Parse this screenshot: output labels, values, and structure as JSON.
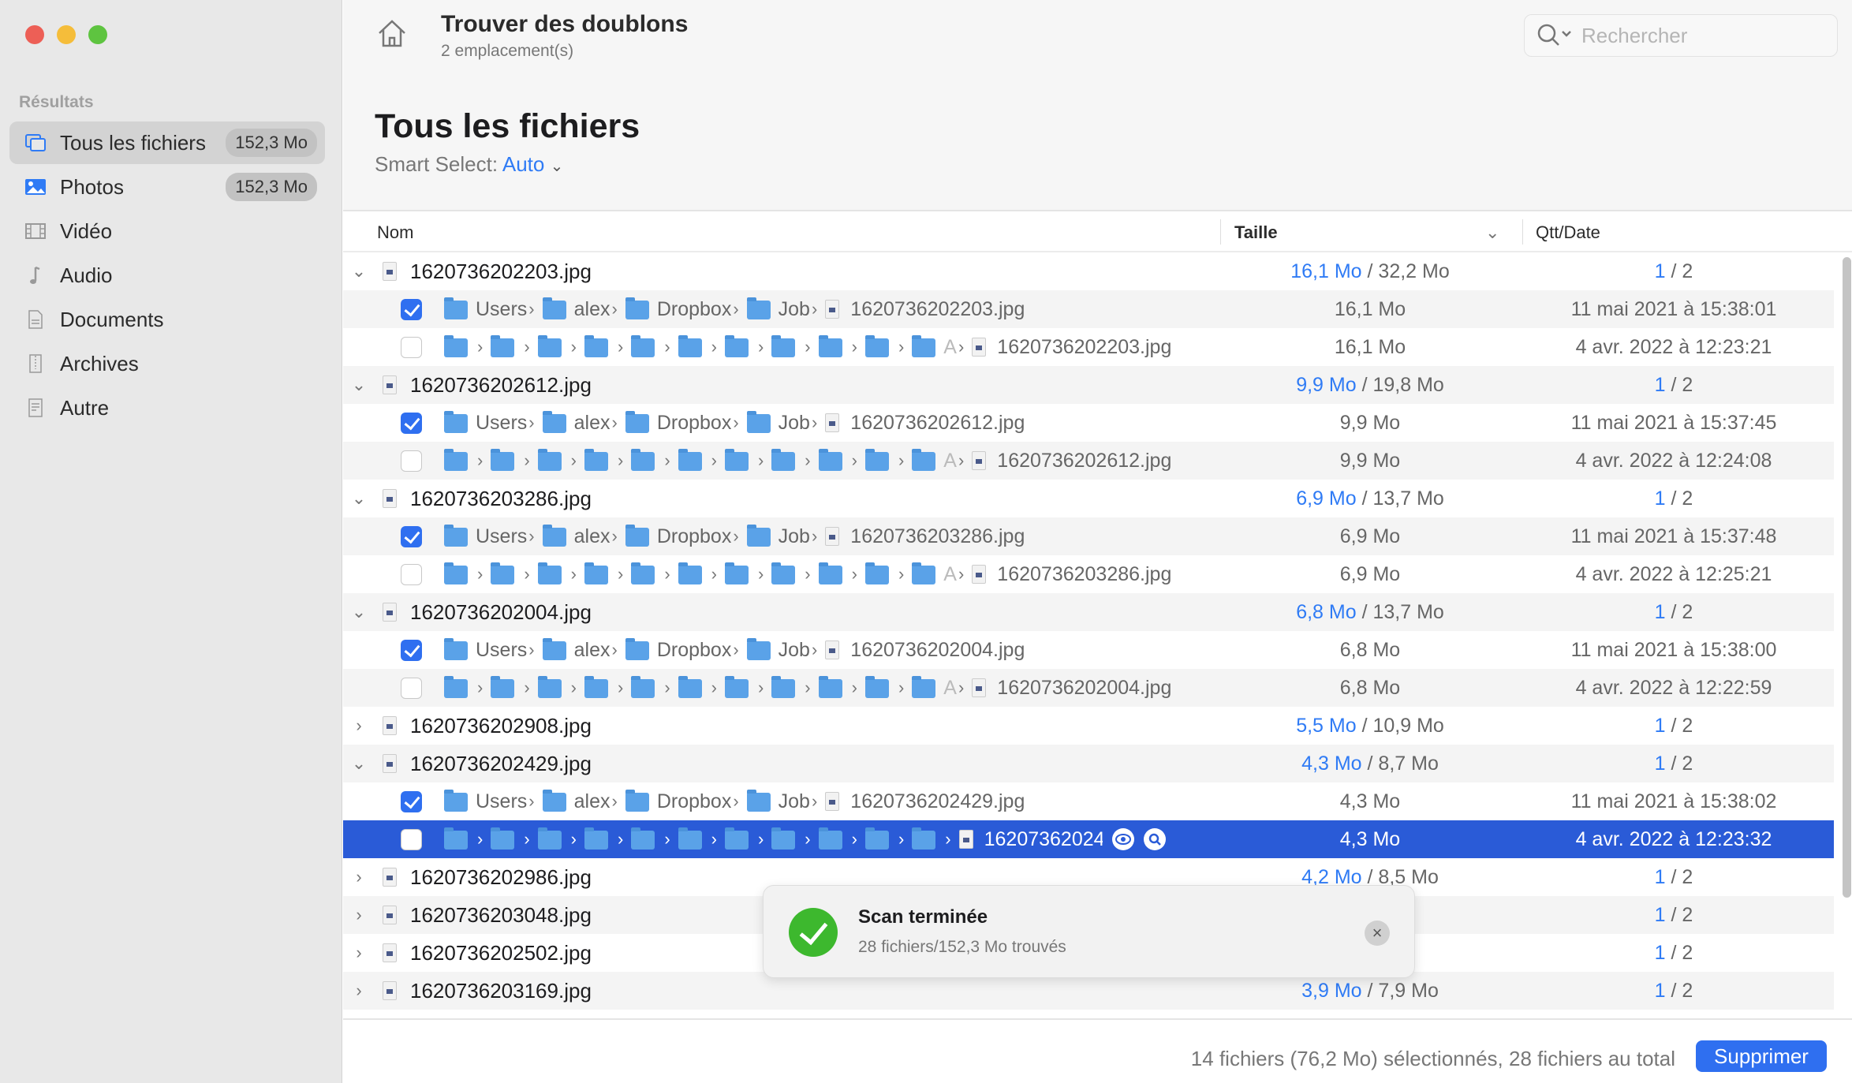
{
  "window": {
    "controls": {
      "close_color": "#ed5f56",
      "minimize_color": "#f5bd3a",
      "zoom_color": "#5ec440"
    }
  },
  "sidebar": {
    "section": "Résultats",
    "items": [
      {
        "label": "Tous les fichiers",
        "badge": "152,3 Mo",
        "icon": "all-files-icon",
        "active": true
      },
      {
        "label": "Photos",
        "badge": "152,3 Mo",
        "icon": "photo-icon"
      },
      {
        "label": "Vidéo",
        "icon": "film-icon"
      },
      {
        "label": "Audio",
        "icon": "music-note-icon"
      },
      {
        "label": "Documents",
        "icon": "document-icon"
      },
      {
        "label": "Archives",
        "icon": "archive-icon"
      },
      {
        "label": "Autre",
        "icon": "other-file-icon"
      }
    ]
  },
  "header": {
    "title": "Trouver des doublons",
    "subtitle": "2 emplacement(s)",
    "search_placeholder": "Rechercher"
  },
  "main": {
    "title": "Tous les fichiers",
    "smart_select_label": "Smart Select:",
    "smart_select_value": "Auto",
    "columns": {
      "name": "Nom",
      "size": "Taille",
      "qty": "Qtt/Date"
    }
  },
  "groups": [
    {
      "name": "1620736202203.jpg",
      "kept": "16,1 Mo",
      "total": "/ 32,2 Mo",
      "qty_sel": "1",
      "qty_total": "/ 2",
      "expanded": true,
      "children": [
        {
          "checked": true,
          "path": [
            "Users",
            "alex",
            "Dropbox",
            "Job"
          ],
          "file": "1620736202203.jpg",
          "size": "16,1 Mo",
          "date": "11 mai 2021 à 15:38:01"
        },
        {
          "checked": false,
          "collapsed": true,
          "file": "1620736202203.jpg",
          "size": "16,1 Mo",
          "date": "4 avr. 2022 à 12:23:21"
        }
      ]
    },
    {
      "name": "1620736202612.jpg",
      "kept": "9,9 Mo",
      "total": "/ 19,8 Mo",
      "qty_sel": "1",
      "qty_total": "/ 2",
      "expanded": true,
      "children": [
        {
          "checked": true,
          "path": [
            "Users",
            "alex",
            "Dropbox",
            "Job"
          ],
          "file": "1620736202612.jpg",
          "size": "9,9 Mo",
          "date": "11 mai 2021 à 15:37:45"
        },
        {
          "checked": false,
          "collapsed": true,
          "file": "1620736202612.jpg",
          "size": "9,9 Mo",
          "date": "4 avr. 2022 à 12:24:08"
        }
      ]
    },
    {
      "name": "1620736203286.jpg",
      "kept": "6,9 Mo",
      "total": "/ 13,7 Mo",
      "qty_sel": "1",
      "qty_total": "/ 2",
      "expanded": true,
      "children": [
        {
          "checked": true,
          "path": [
            "Users",
            "alex",
            "Dropbox",
            "Job"
          ],
          "file": "1620736203286.jpg",
          "size": "6,9 Mo",
          "date": "11 mai 2021 à 15:37:48"
        },
        {
          "checked": false,
          "collapsed": true,
          "file": "1620736203286.jpg",
          "size": "6,9 Mo",
          "date": "4 avr. 2022 à 12:25:21"
        }
      ]
    },
    {
      "name": "1620736202004.jpg",
      "kept": "6,8 Mo",
      "total": "/ 13,7 Mo",
      "qty_sel": "1",
      "qty_total": "/ 2",
      "expanded": true,
      "children": [
        {
          "checked": true,
          "path": [
            "Users",
            "alex",
            "Dropbox",
            "Job"
          ],
          "file": "1620736202004.jpg",
          "size": "6,8 Mo",
          "date": "11 mai 2021 à 15:38:00"
        },
        {
          "checked": false,
          "collapsed": true,
          "file": "1620736202004.jpg",
          "size": "6,8 Mo",
          "date": "4 avr. 2022 à 12:22:59"
        }
      ]
    },
    {
      "name": "1620736202908.jpg",
      "kept": "5,5 Mo",
      "total": "/ 10,9 Mo",
      "qty_sel": "1",
      "qty_total": "/ 2",
      "expanded": false
    },
    {
      "name": "1620736202429.jpg",
      "kept": "4,3 Mo",
      "total": "/ 8,7 Mo",
      "qty_sel": "1",
      "qty_total": "/ 2",
      "expanded": true,
      "children": [
        {
          "checked": true,
          "path": [
            "Users",
            "alex",
            "Dropbox",
            "Job"
          ],
          "file": "1620736202429.jpg",
          "size": "4,3 Mo",
          "date": "11 mai 2021 à 15:38:02"
        },
        {
          "checked": false,
          "collapsed": true,
          "selected": true,
          "file": "1620736202429.jpg",
          "size": "4,3 Mo",
          "date": "4 avr. 2022 à 12:23:32"
        }
      ]
    },
    {
      "name": "1620736202986.jpg",
      "kept": "4,2 Mo",
      "total": "/ 8,5 Mo",
      "qty_sel": "1",
      "qty_total": "/ 2",
      "expanded": false
    },
    {
      "name": "1620736203048.jpg",
      "kept": "",
      "total": "Mo",
      "qty_sel": "1",
      "qty_total": "/ 2",
      "expanded": false
    },
    {
      "name": "1620736202502.jpg",
      "kept": "",
      "total": "Mo",
      "qty_sel": "1",
      "qty_total": "/ 2",
      "expanded": false
    },
    {
      "name": "1620736203169.jpg",
      "kept": "3,9 Mo",
      "total": "/ 7,9 Mo",
      "qty_sel": "1",
      "qty_total": "/ 2",
      "expanded": false
    }
  ],
  "collapsed_path": {
    "folder_count": 11,
    "truncated_marker": "A"
  },
  "toast": {
    "title": "Scan terminée",
    "message": "28 fichiers/152,3 Mo trouvés"
  },
  "footer": {
    "status": "14 fichiers (76,2 Mo) sélectionnés, 28 fichiers au total",
    "delete_label": "Supprimer"
  },
  "colors": {
    "accent": "#2f6ff0",
    "selection": "#2a5bd7",
    "success": "#3db82e"
  }
}
